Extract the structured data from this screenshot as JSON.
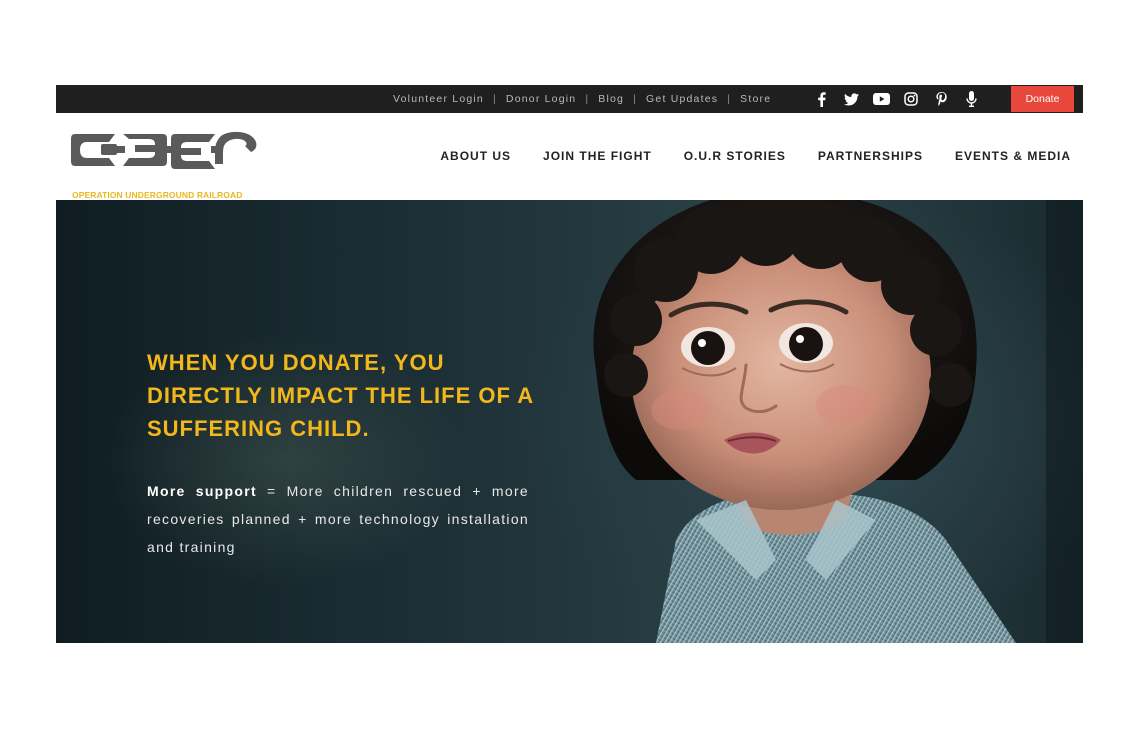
{
  "topbar": {
    "links": [
      "Volunteer Login",
      "Donor Login",
      "Blog",
      "Get Updates",
      "Store"
    ],
    "social_icons": [
      "facebook-icon",
      "twitter-icon",
      "youtube-icon",
      "instagram-icon",
      "pinterest-icon",
      "microphone-icon"
    ],
    "donate_label": "Donate"
  },
  "header": {
    "logo_caption": "OPERATION UNDERGROUND RAILROAD",
    "nav": [
      "ABOUT US",
      "JOIN THE FIGHT",
      "O.U.R STORIES",
      "PARTNERSHIPS",
      "EVENTS & MEDIA"
    ]
  },
  "hero": {
    "heading": "WHEN YOU DONATE, YOU DIRECTLY IMPACT THE LIFE OF A SUFFERING CHILD.",
    "body_bold": "More support",
    "body_rest": " = More children rescued + more recoveries planned + more technology installation and training"
  },
  "colors": {
    "topbar_bg": "#1f1f1f",
    "donate_bg": "#e8483b",
    "accent_yellow": "#f2b71b",
    "logo_gray": "#555555"
  }
}
